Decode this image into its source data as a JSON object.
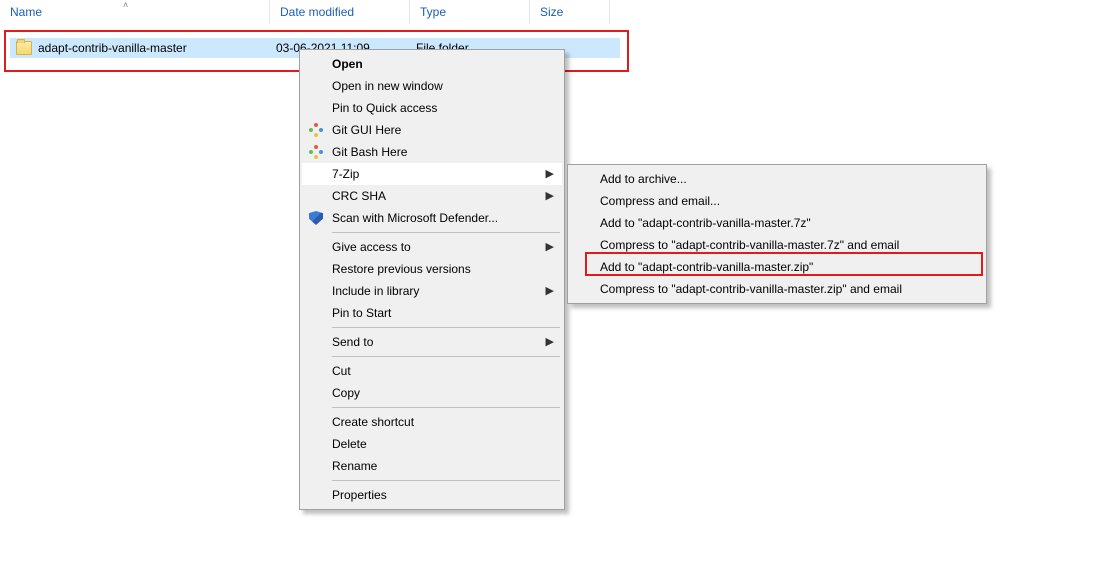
{
  "columns": {
    "name": "Name",
    "date": "Date modified",
    "type": "Type",
    "size": "Size"
  },
  "row": {
    "name": "adapt-contrib-vanilla-master",
    "date": "03-06-2021 11:09",
    "type": "File folder"
  },
  "menu": {
    "open": "Open",
    "open_new": "Open in new window",
    "pin_quick": "Pin to Quick access",
    "git_gui": "Git GUI Here",
    "git_bash": "Git Bash Here",
    "seven_zip": "7-Zip",
    "crc_sha": "CRC SHA",
    "defender": "Scan with Microsoft Defender...",
    "give_access": "Give access to",
    "restore": "Restore previous versions",
    "include_lib": "Include in library",
    "pin_start": "Pin to Start",
    "send_to": "Send to",
    "cut": "Cut",
    "copy": "Copy",
    "shortcut": "Create shortcut",
    "delete": "Delete",
    "rename": "Rename",
    "properties": "Properties"
  },
  "submenu": {
    "add_archive": "Add to archive...",
    "compress_email": "Compress and email...",
    "add_7z": "Add to \"adapt-contrib-vanilla-master.7z\"",
    "compress_7z_email": "Compress to \"adapt-contrib-vanilla-master.7z\" and email",
    "add_zip": "Add to \"adapt-contrib-vanilla-master.zip\"",
    "compress_zip_email": "Compress to \"adapt-contrib-vanilla-master.zip\" and email"
  }
}
